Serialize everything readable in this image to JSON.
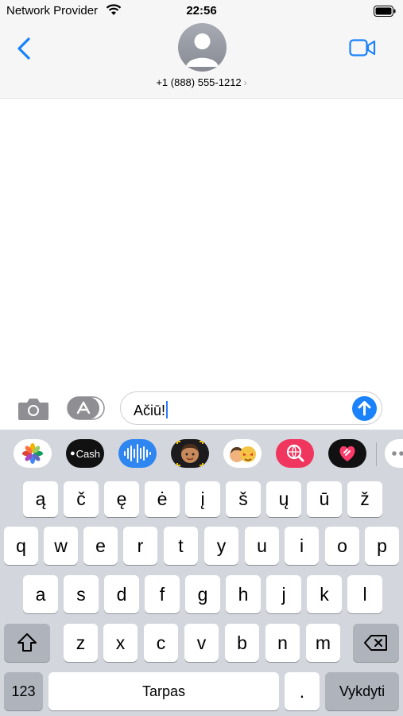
{
  "status_bar": {
    "carrier": "Network Provider",
    "time": "22:56"
  },
  "header": {
    "contact": "+1 (888) 555-1212",
    "contact_chevron": "›"
  },
  "icons": {
    "back": "chevron-left-icon",
    "video": "video-camera-icon",
    "avatar": "person-silhouette-icon",
    "camera": "camera-icon",
    "apps": "app-store-icon",
    "send": "arrow-up-icon",
    "shift": "shift-arrow-icon",
    "delete": "backspace-icon",
    "wifi": "wifi-icon",
    "battery": "battery-icon"
  },
  "colors": {
    "accent": "#1a82fb",
    "keyboard_bg": "#d3d6dc",
    "function_key": "#aeb3bc"
  },
  "composer": {
    "text": "Ačiū!"
  },
  "apps_strip": [
    {
      "name": "photos",
      "label": ""
    },
    {
      "name": "apple-cash",
      "label": "Cash"
    },
    {
      "name": "audio-message",
      "label": ""
    },
    {
      "name": "memoji",
      "label": ""
    },
    {
      "name": "memoji-stickers",
      "label": ""
    },
    {
      "name": "web-search",
      "label": ""
    },
    {
      "name": "digital-touch",
      "label": ""
    },
    {
      "name": "more",
      "label": ""
    }
  ],
  "keyboard": {
    "row0": [
      "ą",
      "č",
      "ę",
      "ė",
      "į",
      "š",
      "ų",
      "ū",
      "ž"
    ],
    "row1": [
      "q",
      "w",
      "e",
      "r",
      "t",
      "y",
      "u",
      "i",
      "o",
      "p"
    ],
    "row2": [
      "a",
      "s",
      "d",
      "f",
      "g",
      "h",
      "j",
      "k",
      "l"
    ],
    "row3": [
      "z",
      "x",
      "c",
      "v",
      "b",
      "n",
      "m"
    ],
    "numbers_label": "123",
    "space_label": "Tarpas",
    "period_label": ".",
    "return_label": "Vykdyti"
  }
}
